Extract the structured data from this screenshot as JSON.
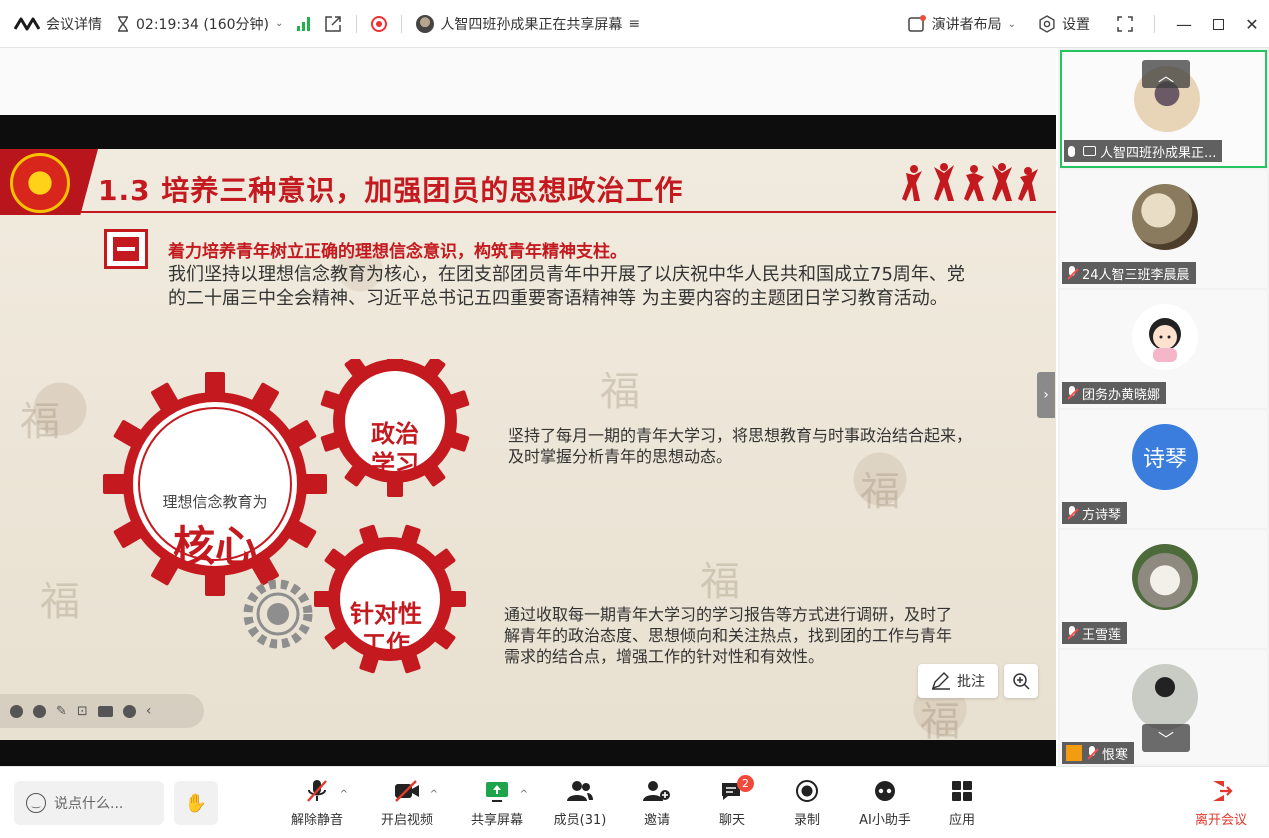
{
  "topbar": {
    "meeting_details": "会议详情",
    "timer": "02:19:34 (160分钟)",
    "sharing_text": "人智四班孙成果正在共享屏幕",
    "layout_label": "演讲者布局",
    "settings_label": "设置"
  },
  "slide": {
    "title": "1.3 培养三种意识，加强团员的思想政治工作",
    "section_heading": "着力培养青年树立正确的理想信念意识，构筑青年精神支柱。",
    "section_paragraph": "我们坚持以理想信念教育为核心，在团支部团员青年中开展了以庆祝中华人民共和国成立75周年、党的二十届三中全会精神、习近平总书记五四重要寄语精神等 为主要内容的主题团日学习教育活动。",
    "gear_core_subtitle": "理想信念教育为",
    "gear_core_title": "核心",
    "gear_politics_title": "政治\n学习",
    "gear_targeted_title": "针对性\n工作",
    "desc_politics": "坚持了每月一期的青年大学习，将思想教育与时事政治结合起来，及时掌握分析青年的思想动态。",
    "desc_targeted": "通过收取每一期青年大学习的学习报告等方式进行调研，及时了解青年的政治态度、思想倾向和关注热点，找到团的工作与青年需求的结合点，增强工作的针对性和有效性。"
  },
  "share_controls": {
    "annotate_label": "批注"
  },
  "participants": [
    {
      "name": "人智四班孙成果正...",
      "sharing": true
    },
    {
      "name": "24人智三班李晨晨",
      "muted": true
    },
    {
      "name": "团务办黄晓娜",
      "muted": true
    },
    {
      "name": "方诗琴",
      "muted": true,
      "avatar_text": "诗琴"
    },
    {
      "name": "王雪莲",
      "muted": true
    },
    {
      "name": "恨寒",
      "muted": true
    }
  ],
  "bottombar": {
    "chat_placeholder": "说点什么...",
    "unmute_label": "解除静音",
    "video_label": "开启视频",
    "share_label": "共享屏幕",
    "members_label": "成员(31)",
    "invite_label": "邀请",
    "chat_label": "聊天",
    "chat_badge": "2",
    "record_label": "录制",
    "ai_label": "AI小助手",
    "apps_label": "应用",
    "leave_label": "离开会议"
  },
  "colors": {
    "accent_red": "#c41a1f",
    "active_border": "#22c55e",
    "signal_green": "#22b14c",
    "leave_red": "#e2392c"
  }
}
